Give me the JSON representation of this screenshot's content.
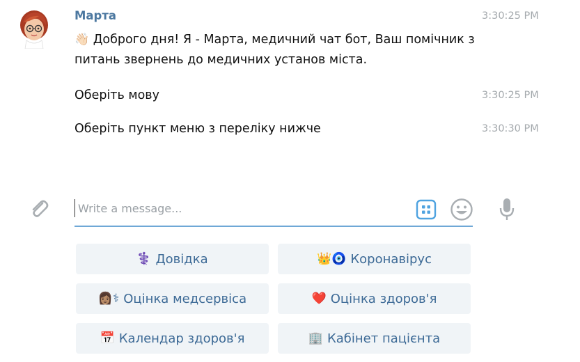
{
  "chat": {
    "sender": "Марта",
    "messages": [
      {
        "emoji": "👋🏻",
        "text": "Доброго дня! Я - Марта, медичний чат бот, Ваш помічник з питань звернень до медичних установ міста.",
        "time": "3:30:25 PM"
      },
      {
        "text": "Оберіть мову",
        "time": "3:30:25 PM"
      },
      {
        "text": "Оберіть пункт меню з переліку нижче",
        "time": "3:30:30 PM"
      }
    ]
  },
  "composer": {
    "placeholder": "Write a message...",
    "value": ""
  },
  "keyboard": {
    "buttons": [
      {
        "emoji": "⚕️",
        "label": "Довідка"
      },
      {
        "emoji": "👑🧿",
        "label": "Коронавірус"
      },
      {
        "emoji": "👩🏽⚕",
        "label": "Оцінка медсервіса"
      },
      {
        "emoji": "❤️",
        "label": "Оцінка здоров'я"
      },
      {
        "emoji": "📅",
        "label": "Календар здоров'я"
      },
      {
        "emoji": "🏢",
        "label": "Кабінет пацієнта"
      }
    ]
  },
  "colors": {
    "accent": "#4c78a0",
    "button_bg": "#f0f4f7",
    "button_text": "#3d6a96",
    "timestamp": "#a4a9ad",
    "composer_border": "#6fa8d6",
    "icon": "#a9aeb2"
  },
  "icons": {
    "attach": "paperclip-icon",
    "keyboard": "bot-keyboard-icon",
    "emoji": "smiley-icon",
    "mic": "microphone-icon"
  }
}
